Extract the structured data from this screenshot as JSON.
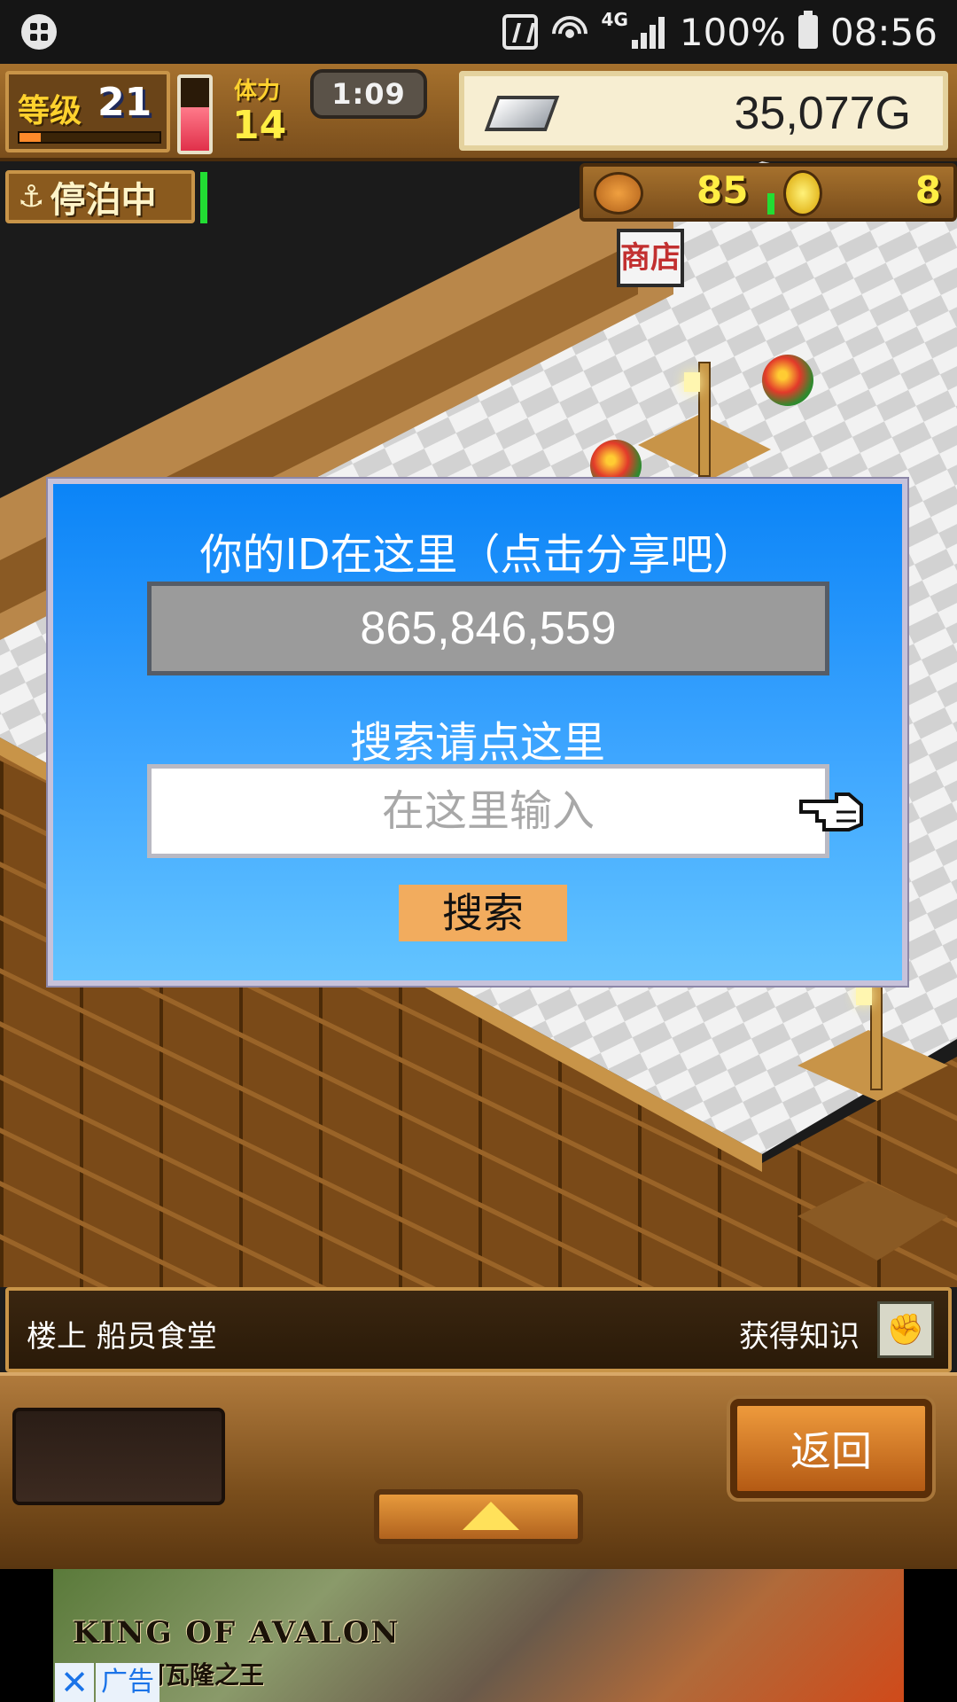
{
  "status_bar": {
    "network": "4G",
    "battery": "100%",
    "time": "08:56"
  },
  "hud": {
    "level_label": "等级",
    "level_value": "21",
    "level_progress": 0.15,
    "stamina_label": "体力",
    "stamina_value": "14",
    "stamina_fill": 0.6,
    "timer": "1:09",
    "gold": "35,077G",
    "status_label": "停泊中",
    "food_value": "85",
    "coin_value": "8"
  },
  "scene": {
    "shop_sign": "商店"
  },
  "dialog": {
    "id_label": "你的ID在这里（点击分享吧）",
    "id_value": "865,846,559",
    "search_label": "搜索请点这里",
    "search_placeholder": "在这里输入",
    "search_button": "搜索"
  },
  "bottom": {
    "location": "楼上 船员食堂",
    "knowledge": "获得知识",
    "back_button": "返回"
  },
  "ad": {
    "title": "KING OF AVALON",
    "subtitle": "阿瓦隆之王",
    "close": "✕",
    "label": "广告"
  },
  "colors": {
    "dialog_top": "#0b84f7",
    "dialog_bottom": "#63c4ff",
    "search_button": "#f2ac5e",
    "id_box": "#9b9b9b"
  }
}
